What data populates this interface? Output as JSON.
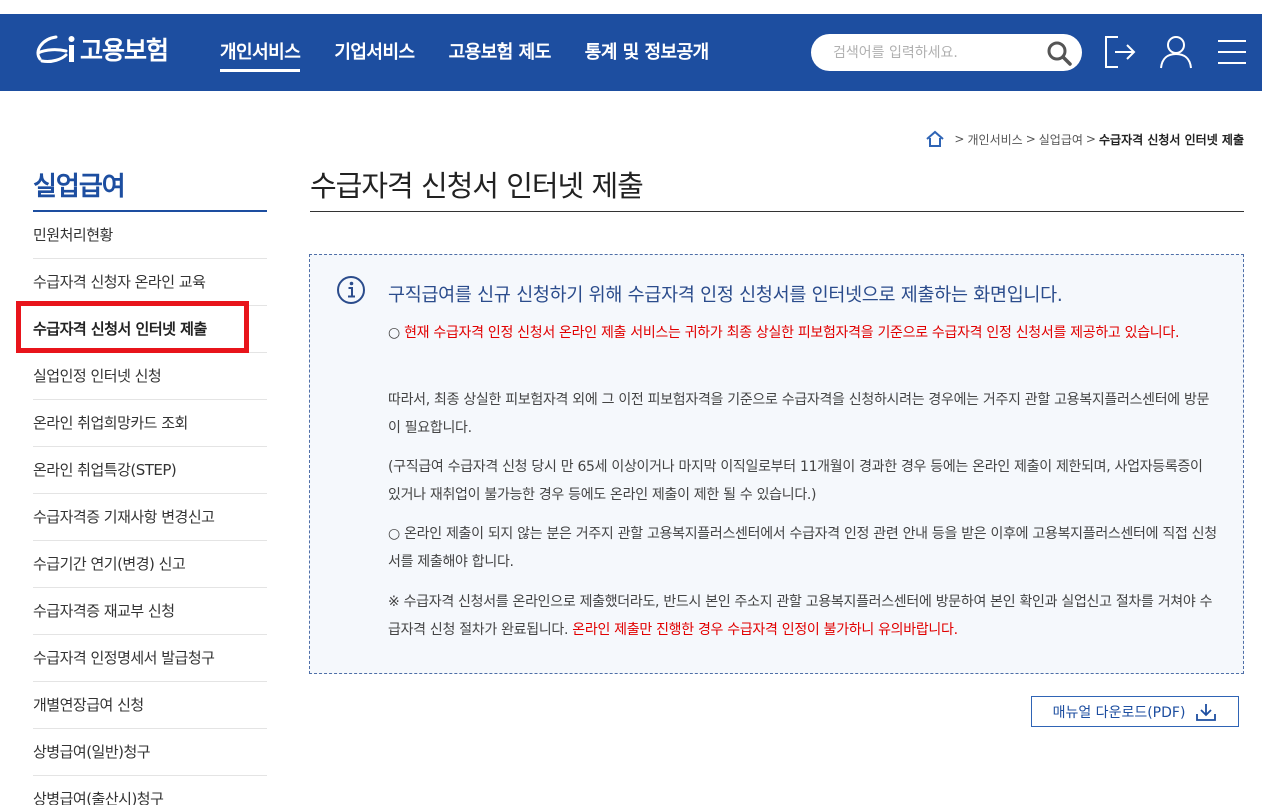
{
  "header": {
    "logo_text": "고용보험",
    "nav": [
      {
        "label": "개인서비스",
        "active": true
      },
      {
        "label": "기업서비스",
        "active": false
      },
      {
        "label": "고용보험 제도",
        "active": false
      },
      {
        "label": "통계 및 정보공개",
        "active": false
      }
    ],
    "search_placeholder": "검색어를 입력하세요.",
    "icons": [
      "search-icon",
      "logout-icon",
      "user-icon",
      "menu-icon"
    ]
  },
  "breadcrumb": {
    "items": [
      "개인서비스",
      "실업급여"
    ],
    "current": "수급자격 신청서 인터넷 제출"
  },
  "sidebar": {
    "title": "실업급여",
    "items": [
      {
        "label": "민원처리현황"
      },
      {
        "label": "수급자격 신청자 온라인 교육"
      },
      {
        "label": "수급자격 신청서 인터넷 제출",
        "active": true
      },
      {
        "label": "실업인정 인터넷 신청"
      },
      {
        "label": "온라인 취업희망카드 조회"
      },
      {
        "label": "온라인 취업특강(STEP)"
      },
      {
        "label": "수급자격증 기재사항 변경신고"
      },
      {
        "label": "수급기간 연기(변경) 신고"
      },
      {
        "label": "수급자격증 재교부 신청"
      },
      {
        "label": "수급자격 인정명세서 발급청구"
      },
      {
        "label": "개별연장급여 신청"
      },
      {
        "label": "상병급여(일반)청구"
      },
      {
        "label": "상병급여(출산시)청구"
      }
    ]
  },
  "main": {
    "title": "수급자격 신청서 인터넷 제출",
    "info": {
      "lead": "구직급여를 신규 신청하기 위해 수급자격 인정 신청서를 인터넷으로 제출하는 화면입니다.",
      "p1_bullet": "○ ",
      "p1_red": "현재 수급자격 인정 신청서 온라인 제출 서비스는 귀하가 최종 상실한 피보험자격을 기준으로 수급자격 인정 신청서를 제공하고 있습니다.",
      "p2": "따라서, 최종 상실한 피보험자격 외에 그 이전 피보험자격을 기준으로 수급자격을 신청하시려는 경우에는 거주지 관할 고용복지플러스센터에 방문이 필요합니다.",
      "p3": "(구직급여 수급자격 신청 당시 만 65세 이상이거나 마지막 이직일로부터 11개월이 경과한 경우 등에는 온라인 제출이 제한되며, 사업자등록증이 있거나 재취업이 불가능한 경우 등에도 온라인 제출이 제한 될 수 있습니다.)",
      "p4": "○ 온라인 제출이 되지 않는 분은 거주지 관할 고용복지플러스센터에서 수급자격 인정 관련 안내 등을 받은 이후에 고용복지플러스센터에 직접 신청서를 제출해야 합니다.",
      "p5_normal": "※ 수급자격 신청서를 온라인으로 제출했더라도, 반드시 본인 주소지 관할 고용복지플러스센터에 방문하여 본인 확인과 실업신고 절차를 거쳐야 수급자격 신청 절차가 완료됩니다. ",
      "p5_red": "온라인 제출만 진행한 경우 수급자격 인정이 불가하니 유의바랍니다."
    },
    "download_label": "매뉴얼 다운로드(PDF)"
  },
  "colors": {
    "brand": "#1d4ea0",
    "highlight": "#e8141b",
    "warning_text": "#e10000"
  }
}
